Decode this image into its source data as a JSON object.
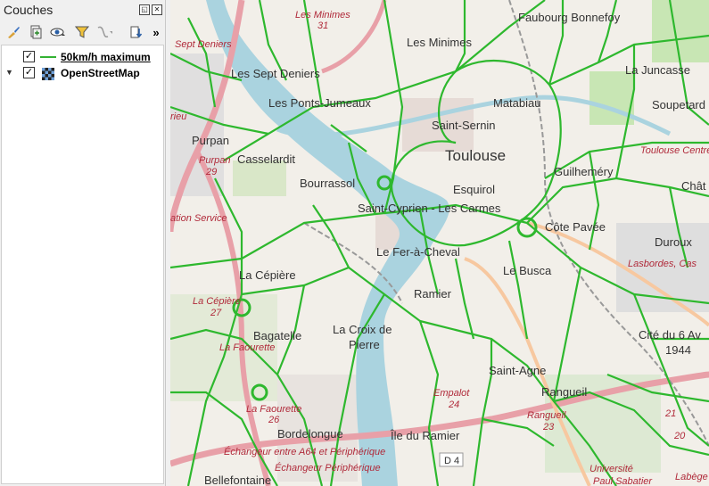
{
  "panel": {
    "title": "Couches",
    "toolbar_overflow": "»",
    "toolbar_icons": [
      "style-manager-icon",
      "add-group-icon",
      "visibility-icon",
      "filter-icon",
      "filter-expression-icon",
      "expand-all-icon"
    ]
  },
  "layers": [
    {
      "name": "50km/h maximum",
      "checked": true,
      "symbol_color": "#33b233"
    },
    {
      "name": "OpenStreetMap",
      "checked": true
    }
  ],
  "map": {
    "places": [
      {
        "name": "Faubourg Bonnefoy"
      },
      {
        "name": "Les Minimes"
      },
      {
        "name": "Les Minimes"
      },
      {
        "name": "Les Sept Deniers"
      },
      {
        "name": "La Juncasse"
      },
      {
        "name": "Les Ponts-Jumeaux"
      },
      {
        "name": "Matabiau"
      },
      {
        "name": "Soupetard"
      },
      {
        "name": "Saint-Sernin"
      },
      {
        "name": "Purpan"
      },
      {
        "name": "Toulouse"
      },
      {
        "name": "Casselardit"
      },
      {
        "name": "Guilheméry"
      },
      {
        "name": "Bourrassol"
      },
      {
        "name": "Esquirol"
      },
      {
        "name": "Saint-Cyprien - Les Carmes"
      },
      {
        "name": "Côte Pavée"
      },
      {
        "name": "Duroux"
      },
      {
        "name": "Le Fer-à-Cheval"
      },
      {
        "name": "La Cépière"
      },
      {
        "name": "Le Busca"
      },
      {
        "name": "Ramier"
      },
      {
        "name": "Bagatelle"
      },
      {
        "name": "La Croix de"
      },
      {
        "name": "Pierre"
      },
      {
        "name": "Cité du 6 Av"
      },
      {
        "name": "1944"
      },
      {
        "name": "Saint-Agne"
      },
      {
        "name": "Rangueil"
      },
      {
        "name": "Bordelongue"
      },
      {
        "name": "Île du Ramier"
      },
      {
        "name": "Bellefontaine"
      },
      {
        "name": "Université"
      },
      {
        "name": "Paul Sabatier"
      },
      {
        "name": "Chât"
      }
    ],
    "road_labels": [
      {
        "text": "Les Minimes"
      },
      {
        "text": "31"
      },
      {
        "text": "Sept Deniers"
      },
      {
        "text": "rieu"
      },
      {
        "text": "Purpan"
      },
      {
        "text": "29"
      },
      {
        "text": "ation Service"
      },
      {
        "text": "La Cépière"
      },
      {
        "text": "27"
      },
      {
        "text": "La Faourette"
      },
      {
        "text": "Toulouse Centre"
      },
      {
        "text": "Lasbordes, Cas"
      },
      {
        "text": "Empalot"
      },
      {
        "text": "24"
      },
      {
        "text": "Rangueil"
      },
      {
        "text": "23"
      },
      {
        "text": "La Faourette"
      },
      {
        "text": "26"
      },
      {
        "text": "Échangeur entre A64 et Périphérique"
      },
      {
        "text": "Échangeur Périphérique"
      },
      {
        "text": "21"
      },
      {
        "text": "Labège"
      },
      {
        "text": "20"
      }
    ],
    "road_number": "D 4",
    "colors": {
      "limit_road": "#2eb82e",
      "motorway": "#e8a0a8",
      "river": "#aad3df",
      "land": "#f2efe9"
    }
  }
}
